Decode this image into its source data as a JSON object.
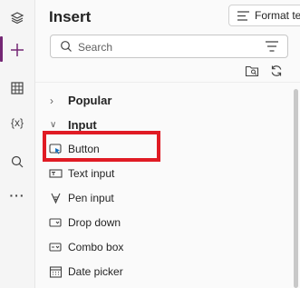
{
  "pane": {
    "title": "Insert"
  },
  "toolbar": {
    "format_label": "Format te"
  },
  "search": {
    "placeholder": "Search"
  },
  "sections": [
    {
      "label": "Popular",
      "expanded": false
    },
    {
      "label": "Input",
      "expanded": true
    }
  ],
  "items": [
    {
      "label": "Button",
      "icon": "button-icon"
    },
    {
      "label": "Text input",
      "icon": "text-input-icon"
    },
    {
      "label": "Pen input",
      "icon": "pen-icon"
    },
    {
      "label": "Drop down",
      "icon": "dropdown-icon"
    },
    {
      "label": "Combo box",
      "icon": "combobox-icon"
    },
    {
      "label": "Date picker",
      "icon": "calendar-icon"
    }
  ],
  "rail": {
    "variables_label": "{x}",
    "more_label": "···"
  },
  "colors": {
    "accent": "#742774",
    "highlight": "#e01b24"
  }
}
